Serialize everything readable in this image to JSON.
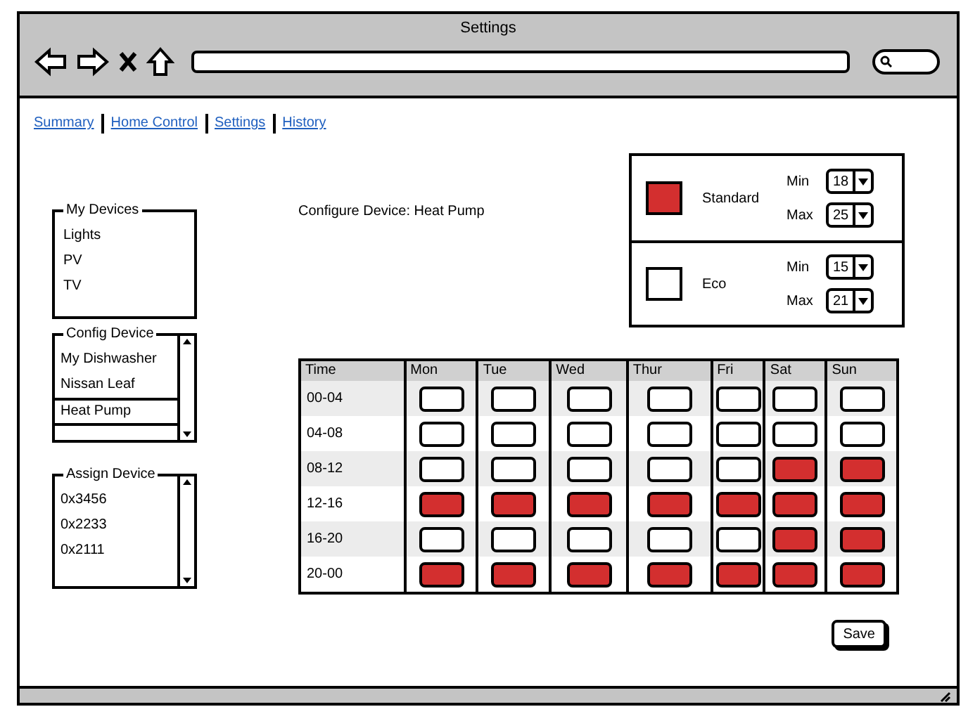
{
  "window": {
    "title": "Settings"
  },
  "nav": [
    {
      "label": "Summary"
    },
    {
      "label": "Home Control"
    },
    {
      "label": "Settings"
    },
    {
      "label": "History"
    }
  ],
  "my_devices": {
    "title": "My Devices",
    "items": [
      "Lights",
      "PV",
      "TV"
    ]
  },
  "config_device": {
    "title": "Config Device",
    "items": [
      {
        "label": "My Dishwasher",
        "selected": false
      },
      {
        "label": "Nissan Leaf",
        "selected": false
      },
      {
        "label": "Heat Pump",
        "selected": true
      }
    ]
  },
  "assign_device": {
    "title": "Assign Device",
    "items": [
      "0x3456",
      "0x2233",
      "0x2111"
    ]
  },
  "heading": "Configure Device: Heat Pump",
  "modes": [
    {
      "name": "Standard",
      "color": "#d32f2f",
      "min_label": "Min",
      "min": "18",
      "max_label": "Max",
      "max": "25"
    },
    {
      "name": "Eco",
      "color": "#ffffff",
      "min_label": "Min",
      "min": "15",
      "max_label": "Max",
      "max": "21"
    }
  ],
  "schedule": {
    "columns": [
      "Time",
      "Mon",
      "Tue",
      "Wed",
      "Thur",
      "Fri",
      "Sat",
      "Sun"
    ],
    "rows": [
      {
        "time": "00-04",
        "slots": [
          false,
          false,
          false,
          false,
          false,
          false,
          false
        ]
      },
      {
        "time": "04-08",
        "slots": [
          false,
          false,
          false,
          false,
          false,
          false,
          false
        ]
      },
      {
        "time": "08-12",
        "slots": [
          false,
          false,
          false,
          false,
          false,
          true,
          true
        ]
      },
      {
        "time": "12-16",
        "slots": [
          true,
          true,
          true,
          true,
          true,
          true,
          true
        ]
      },
      {
        "time": "16-20",
        "slots": [
          false,
          false,
          false,
          false,
          false,
          true,
          true
        ]
      },
      {
        "time": "20-00",
        "slots": [
          true,
          true,
          true,
          true,
          true,
          true,
          true
        ]
      }
    ]
  },
  "save_button": "Save"
}
